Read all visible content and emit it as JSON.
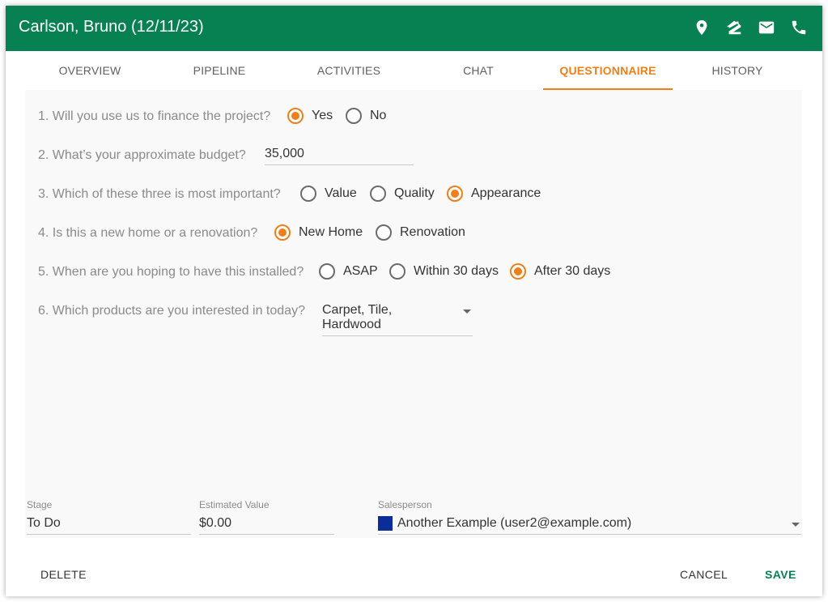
{
  "header": {
    "title": "Carlson, Bruno (12/11/23)",
    "icons": [
      "location-pin-icon",
      "zillow-icon",
      "mail-icon",
      "phone-icon"
    ],
    "background": "#078052"
  },
  "tabs": [
    {
      "label": "OVERVIEW",
      "active": false
    },
    {
      "label": "PIPELINE",
      "active": false
    },
    {
      "label": "ACTIVITIES",
      "active": false
    },
    {
      "label": "CHAT",
      "active": false
    },
    {
      "label": "QUESTIONNAIRE",
      "active": true
    },
    {
      "label": "HISTORY",
      "active": false
    }
  ],
  "accent": "#ef7f1a",
  "questions": {
    "q1": {
      "text": "1. Will you use us to finance the project?",
      "options": [
        "Yes",
        "No"
      ],
      "selected": "Yes"
    },
    "q2": {
      "text": "2. What’s your approximate budget?",
      "value": "35,000"
    },
    "q3": {
      "text": "3. Which of these three is most important?",
      "options": [
        "Value",
        "Quality",
        "Appearance"
      ],
      "selected": "Appearance"
    },
    "q4": {
      "text": "4. Is this a new home or a renovation?",
      "options": [
        "New Home",
        "Renovation"
      ],
      "selected": "New Home"
    },
    "q5": {
      "text": "5. When are you hoping to have this installed?",
      "options": [
        "ASAP",
        "Within 30 days",
        "After 30 days"
      ],
      "selected": "After 30 days"
    },
    "q6": {
      "text": "6. Which products are you interested in today?",
      "value": "Carpet, Tile, Hardwood"
    }
  },
  "fields": {
    "stage": {
      "label": "Stage",
      "value": "To Do"
    },
    "estimated_value": {
      "label": "Estimated Value",
      "value": "$0.00"
    },
    "salesperson": {
      "label": "Salesperson",
      "value": "Another Example (user2@example.com)",
      "color": "#0a2d99"
    }
  },
  "footer": {
    "delete_label": "DELETE",
    "cancel_label": "CANCEL",
    "save_label": "SAVE"
  }
}
